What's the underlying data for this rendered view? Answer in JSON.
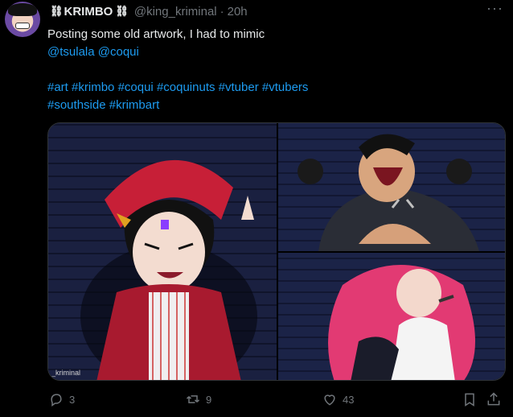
{
  "author": {
    "name": "KRIMBO",
    "name_decor": "⛓",
    "handle": "@king_kriminal",
    "separator": "·",
    "time": "20h"
  },
  "more_label": "···",
  "tweet_text": {
    "line1": "Posting some old artwork, I had to mimic",
    "mentions": [
      "@tsulala",
      "@coqui"
    ],
    "hashtags_line1": [
      "#art",
      "#krimbo",
      "#coqui",
      "#coquinuts",
      "#vtuber",
      "#vtubers"
    ],
    "hashtags_line2": [
      "#southside",
      "#krimbart"
    ]
  },
  "media": {
    "watermark": "_kriminal"
  },
  "actions": {
    "replies": "3",
    "reposts": "9",
    "likes": "43"
  },
  "colors": {
    "background": "#000000",
    "text": "#e7e9ea",
    "muted": "#71767b",
    "link": "#1d9bf0",
    "border": "#2f3336"
  }
}
